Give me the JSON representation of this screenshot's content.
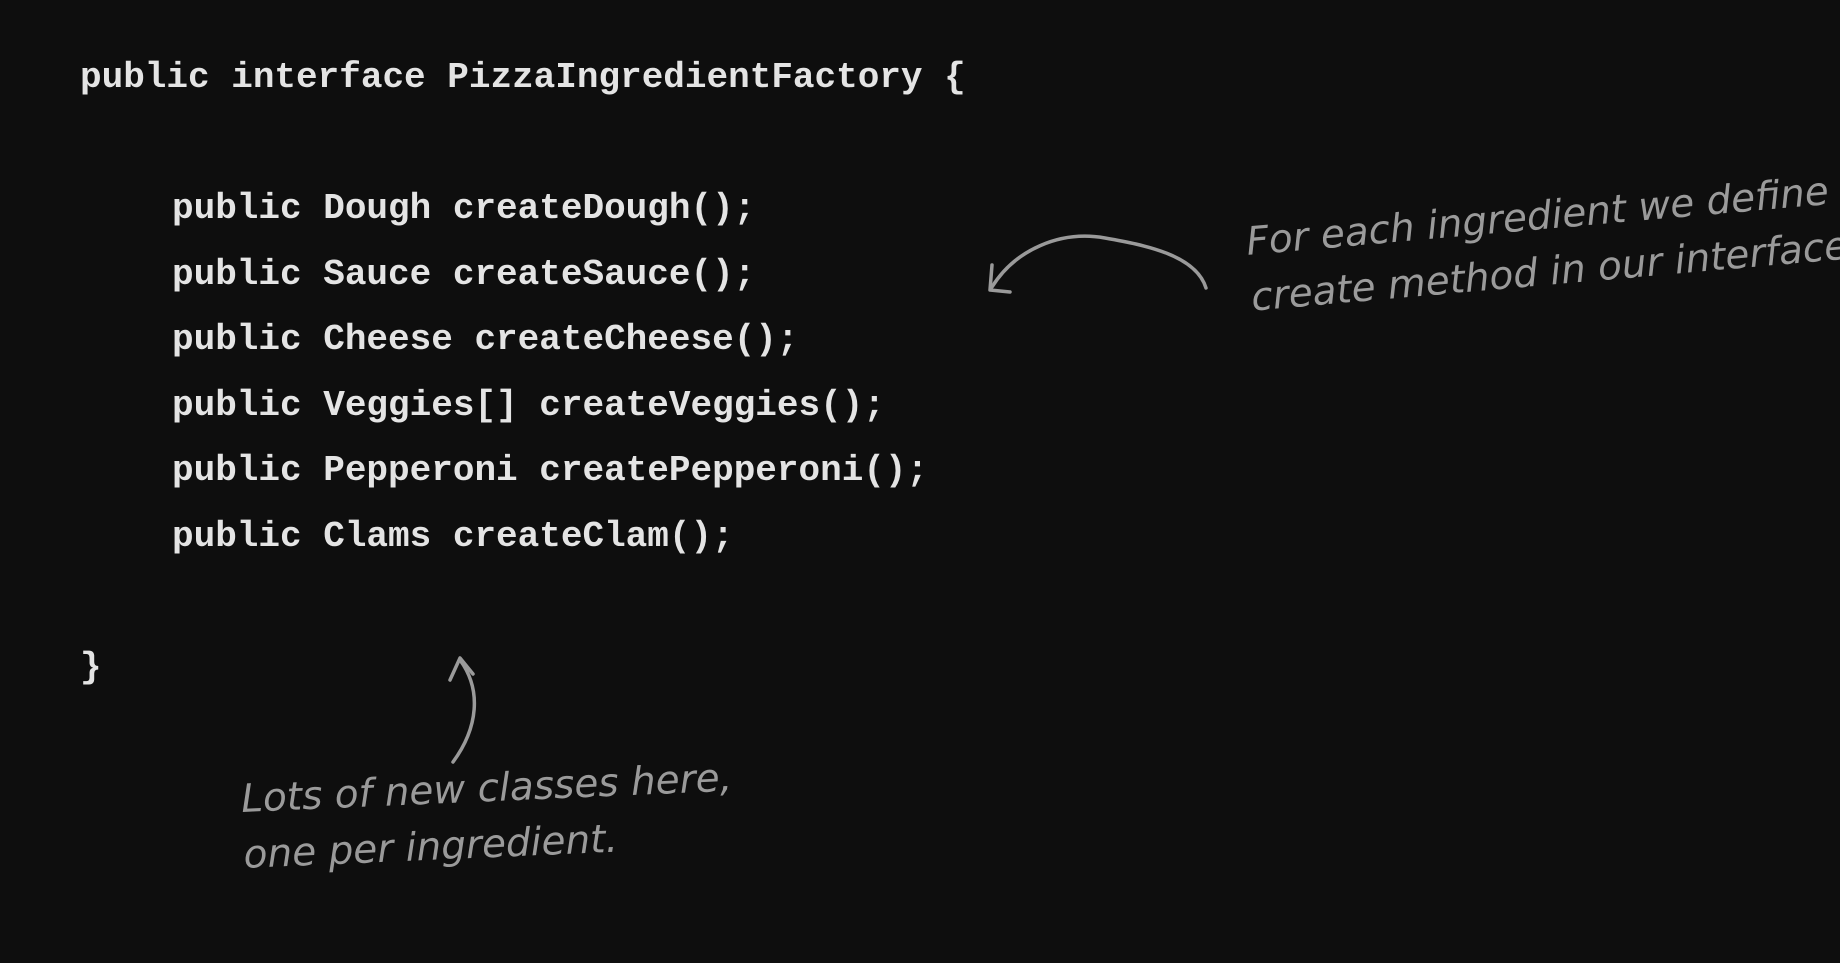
{
  "code": {
    "declaration": "public interface PizzaIngredientFactory {",
    "methods": [
      "public Dough createDough();",
      "public Sauce createSauce();",
      "public Cheese createCheese();",
      "public Veggies[] createVeggies();",
      "public Pepperoni createPepperoni();",
      "public Clams createClam();"
    ],
    "closing_brace": "}"
  },
  "annotations": {
    "right_note": {
      "line1": "For each ingredient we define a",
      "line2": "create method in our interface."
    },
    "bottom_note": {
      "line1": "Lots of new classes here,",
      "line2": "one per ingredient."
    }
  },
  "colors": {
    "background": "#0e0e0e",
    "code_text": "#e4e4e4",
    "annotation": "#9a9a9a"
  }
}
